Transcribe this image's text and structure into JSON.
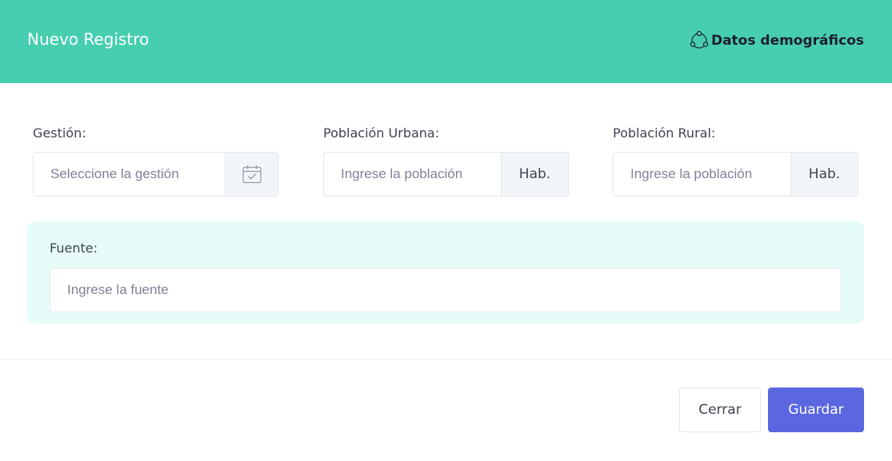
{
  "header": {
    "title": "Nuevo Registro",
    "section_label": "Datos demográficos",
    "section_icon": "circle-nodes-icon",
    "background_color": "#47ceb0"
  },
  "form": {
    "gestion": {
      "label": "Gestión:",
      "placeholder": "Seleccione la gestión",
      "value": "",
      "icon": "calendar-check-icon"
    },
    "poblacion_urbana": {
      "label": "Población Urbana:",
      "placeholder": "Ingrese la población",
      "value": "",
      "addon": "Hab."
    },
    "poblacion_rural": {
      "label": "Población Rural:",
      "placeholder": "Ingrese la población",
      "value": "",
      "addon": "Hab."
    },
    "fuente": {
      "label": "Fuente:",
      "placeholder": "Ingrese la fuente",
      "value": "",
      "box_color": "#e6fcf8"
    }
  },
  "footer": {
    "close_label": "Cerrar",
    "save_label": "Guardar",
    "save_color": "#5b67e0"
  }
}
